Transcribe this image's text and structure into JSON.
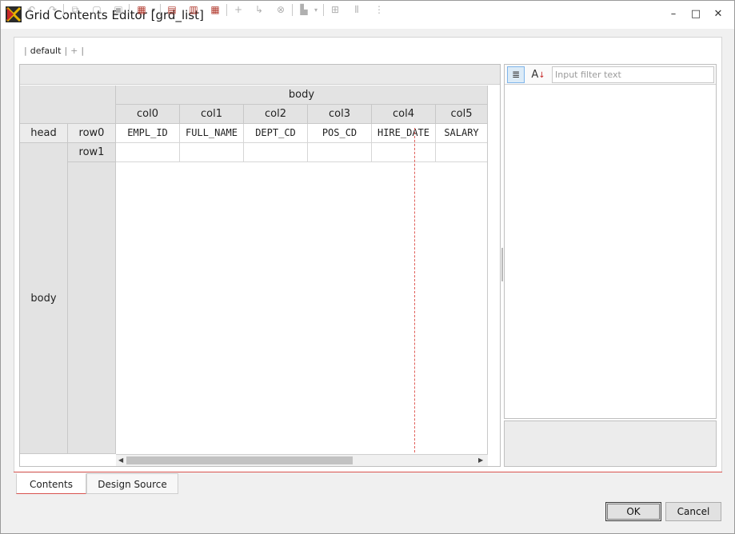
{
  "window": {
    "title": "Grid Contents Editor [grd_list]",
    "minimize_glyph": "–",
    "maximize_glyph": "□",
    "close_glyph": "✕"
  },
  "doc_tabs": {
    "active": "default",
    "add": "+"
  },
  "toolbar": {
    "icons": [
      "undo-icon",
      "redo-icon",
      "cut-icon",
      "copy-icon",
      "paste-icon",
      "insert-column-icon",
      "add-head-row-icon",
      "add-body-row-icon",
      "add-summ-row-icon",
      "add-icon",
      "move-icon",
      "delete-icon",
      "merge-icon",
      "split-icon",
      "distribute-icon",
      "align-icon"
    ]
  },
  "grid": {
    "band_title": "body",
    "columns": [
      "col0",
      "col1",
      "col2",
      "col3",
      "col4",
      "col5"
    ],
    "head_label": "head",
    "body_label": "body",
    "rows": [
      "row0",
      "row1"
    ],
    "row0_cells": [
      "EMPL_ID",
      "FULL_NAME",
      "DEPT_CD",
      "POS_CD",
      "HIRE_DATE",
      "SALARY"
    ]
  },
  "properties": {
    "filter_placeholder": "Input filter text",
    "sort_category_icon": "categorized-icon",
    "sort_alpha_label": "A"
  },
  "bottom_tabs": [
    "Contents",
    "Design Source"
  ],
  "buttons": {
    "ok": "OK",
    "cancel": "Cancel"
  },
  "colors": {
    "accent": "#d9534f",
    "header_bg": "#e3e3e3"
  }
}
